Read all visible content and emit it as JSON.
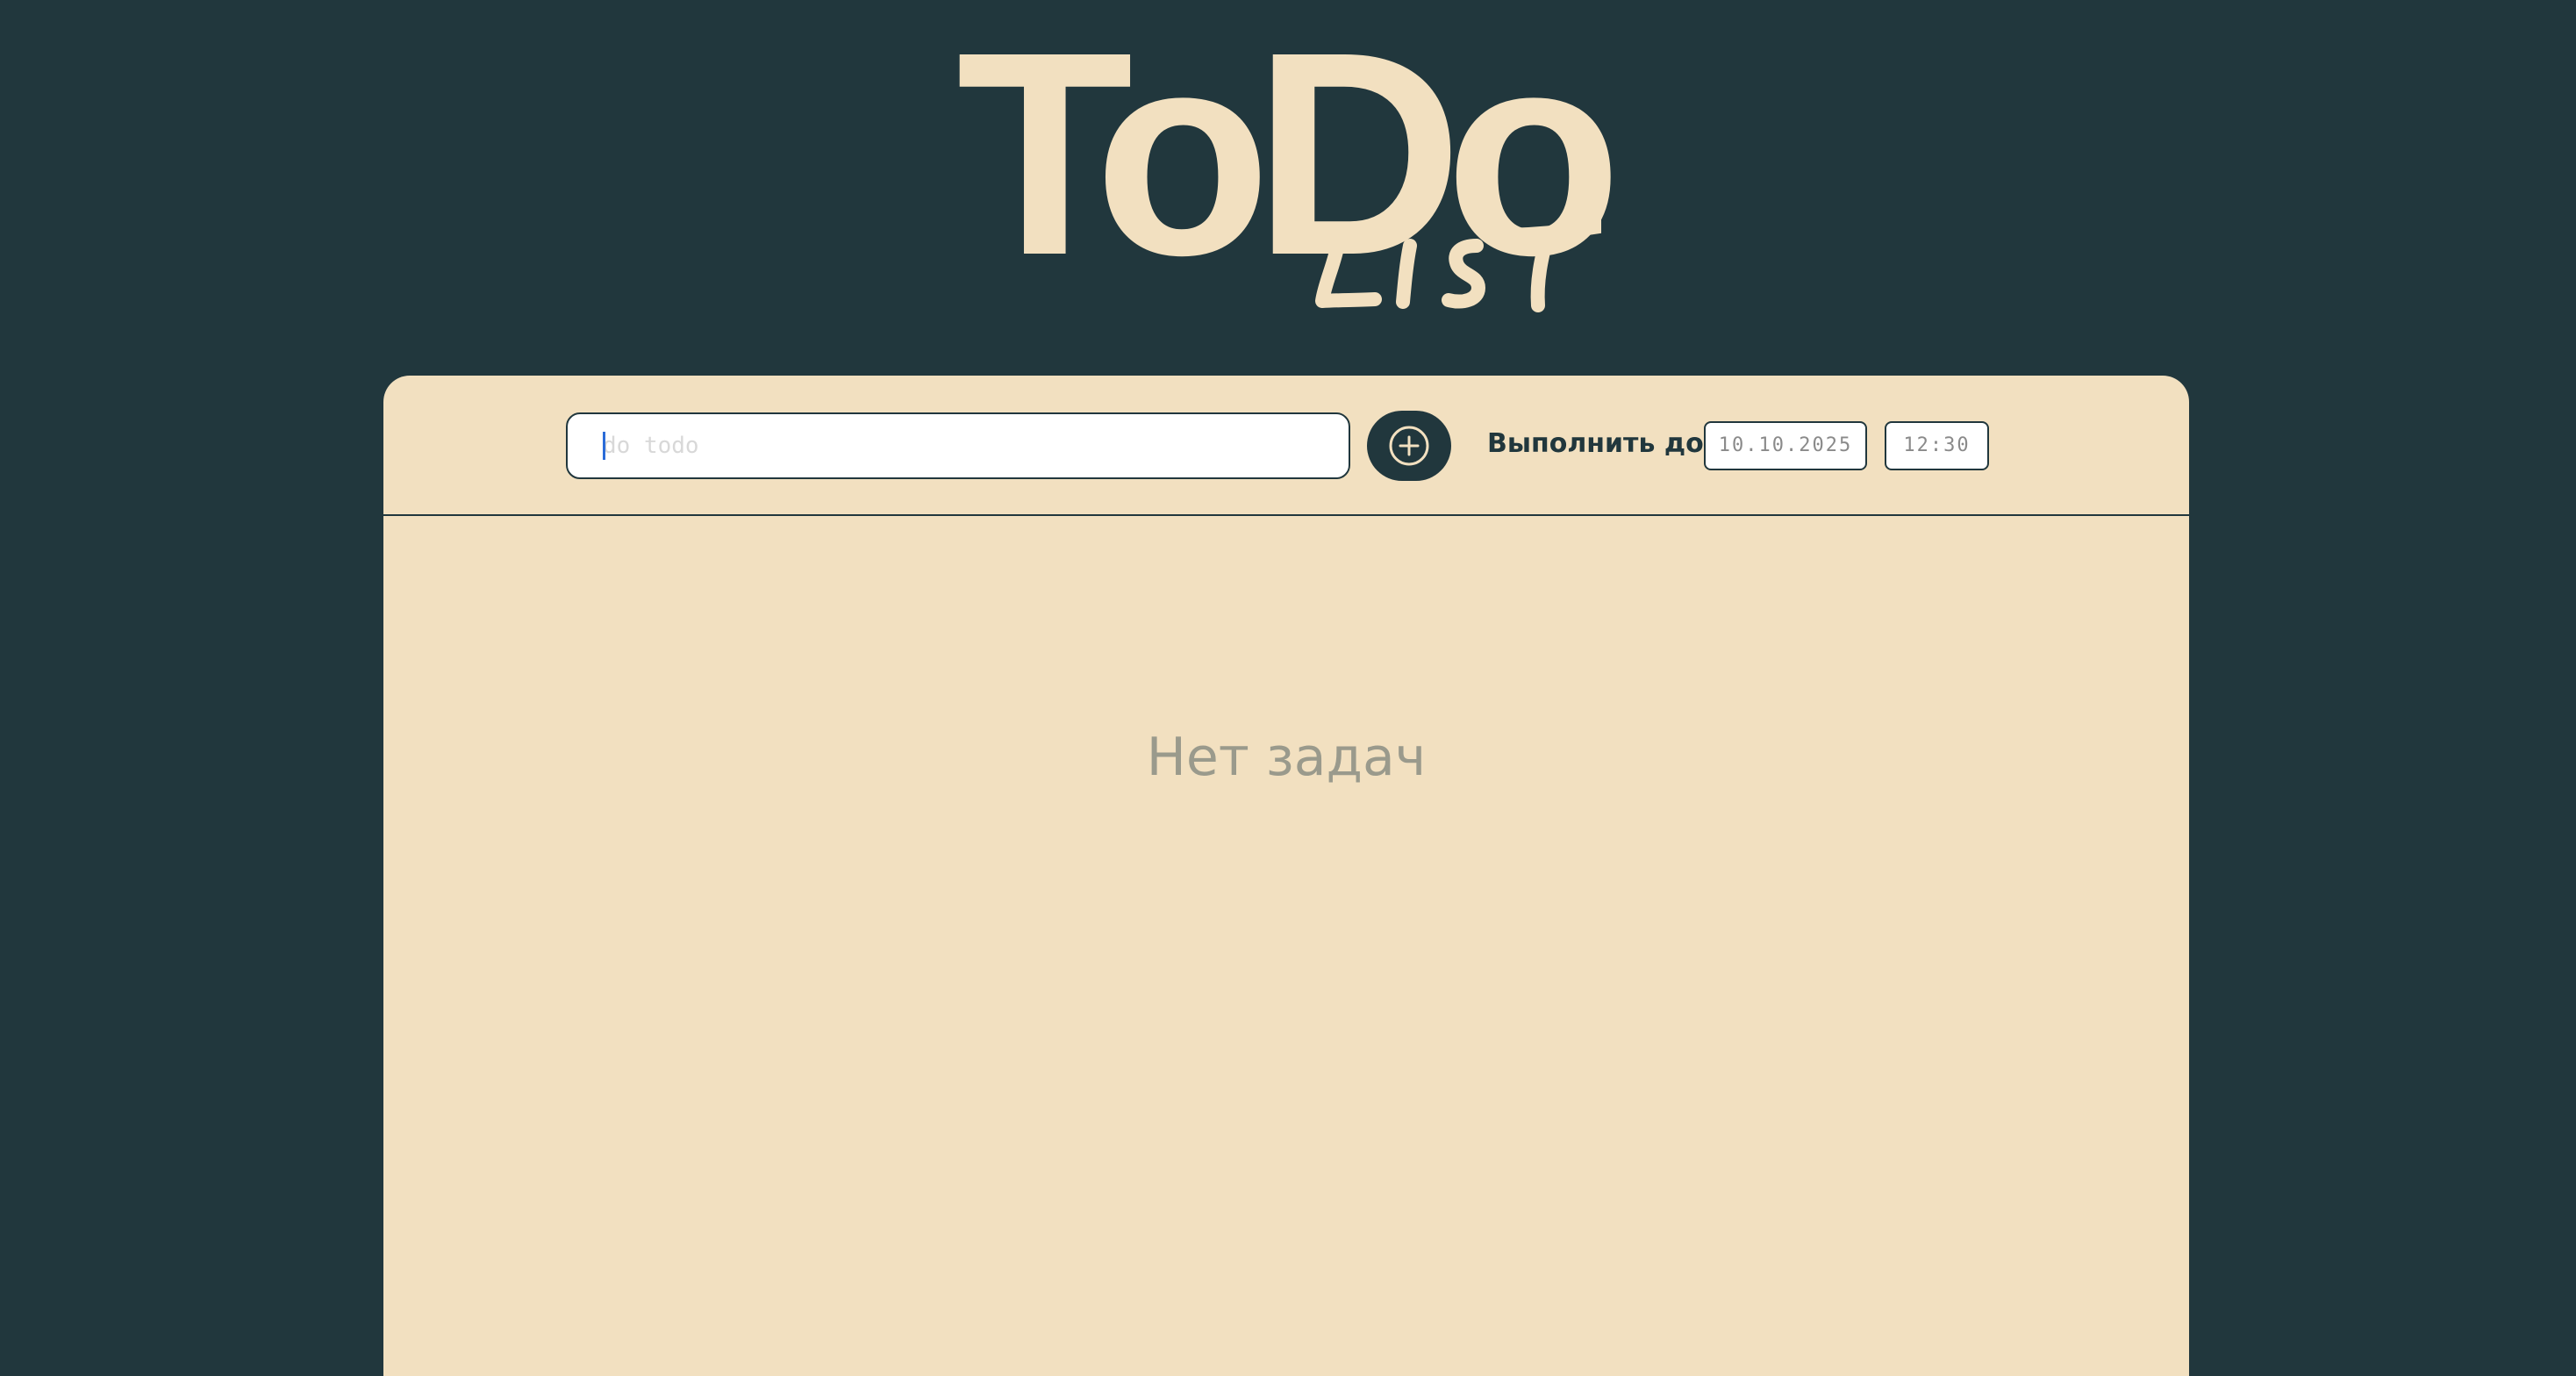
{
  "app": {
    "logo_title": "ToDo",
    "logo_subtitle": "LIST"
  },
  "toolbar": {
    "task_input_value": "",
    "task_input_placeholder": "do todo",
    "add_button_icon": "plus-circle-icon",
    "due_label": "Выполнить до:",
    "due_date": "10.10.2025",
    "due_time": "12:30"
  },
  "list": {
    "empty_message": "Нет задач"
  },
  "colors": {
    "background": "#21373d",
    "card": "#f2e0c0",
    "accent": "#21373d",
    "muted_text": "#9a9a8c"
  }
}
